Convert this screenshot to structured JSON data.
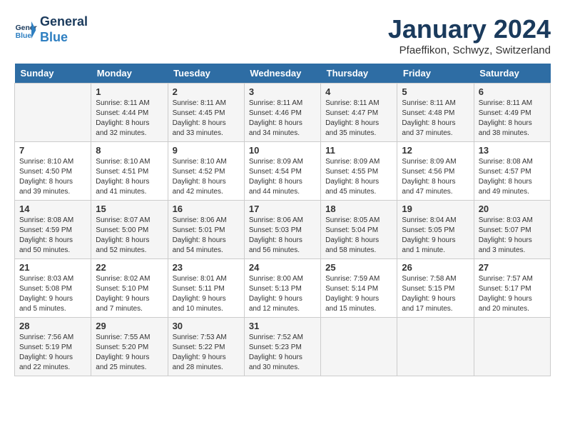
{
  "header": {
    "logo_line1": "General",
    "logo_line2": "Blue",
    "month_title": "January 2024",
    "subtitle": "Pfaeffikon, Schwyz, Switzerland"
  },
  "days_of_week": [
    "Sunday",
    "Monday",
    "Tuesday",
    "Wednesday",
    "Thursday",
    "Friday",
    "Saturday"
  ],
  "weeks": [
    [
      {
        "day": "",
        "sunrise": "",
        "sunset": "",
        "daylight": ""
      },
      {
        "day": "1",
        "sunrise": "8:11 AM",
        "sunset": "4:44 PM",
        "daylight": "8 hours and 32 minutes."
      },
      {
        "day": "2",
        "sunrise": "8:11 AM",
        "sunset": "4:45 PM",
        "daylight": "8 hours and 33 minutes."
      },
      {
        "day": "3",
        "sunrise": "8:11 AM",
        "sunset": "4:46 PM",
        "daylight": "8 hours and 34 minutes."
      },
      {
        "day": "4",
        "sunrise": "8:11 AM",
        "sunset": "4:47 PM",
        "daylight": "8 hours and 35 minutes."
      },
      {
        "day": "5",
        "sunrise": "8:11 AM",
        "sunset": "4:48 PM",
        "daylight": "8 hours and 37 minutes."
      },
      {
        "day": "6",
        "sunrise": "8:11 AM",
        "sunset": "4:49 PM",
        "daylight": "8 hours and 38 minutes."
      }
    ],
    [
      {
        "day": "7",
        "sunrise": "8:10 AM",
        "sunset": "4:50 PM",
        "daylight": "8 hours and 39 minutes."
      },
      {
        "day": "8",
        "sunrise": "8:10 AM",
        "sunset": "4:51 PM",
        "daylight": "8 hours and 41 minutes."
      },
      {
        "day": "9",
        "sunrise": "8:10 AM",
        "sunset": "4:52 PM",
        "daylight": "8 hours and 42 minutes."
      },
      {
        "day": "10",
        "sunrise": "8:09 AM",
        "sunset": "4:54 PM",
        "daylight": "8 hours and 44 minutes."
      },
      {
        "day": "11",
        "sunrise": "8:09 AM",
        "sunset": "4:55 PM",
        "daylight": "8 hours and 45 minutes."
      },
      {
        "day": "12",
        "sunrise": "8:09 AM",
        "sunset": "4:56 PM",
        "daylight": "8 hours and 47 minutes."
      },
      {
        "day": "13",
        "sunrise": "8:08 AM",
        "sunset": "4:57 PM",
        "daylight": "8 hours and 49 minutes."
      }
    ],
    [
      {
        "day": "14",
        "sunrise": "8:08 AM",
        "sunset": "4:59 PM",
        "daylight": "8 hours and 50 minutes."
      },
      {
        "day": "15",
        "sunrise": "8:07 AM",
        "sunset": "5:00 PM",
        "daylight": "8 hours and 52 minutes."
      },
      {
        "day": "16",
        "sunrise": "8:06 AM",
        "sunset": "5:01 PM",
        "daylight": "8 hours and 54 minutes."
      },
      {
        "day": "17",
        "sunrise": "8:06 AM",
        "sunset": "5:03 PM",
        "daylight": "8 hours and 56 minutes."
      },
      {
        "day": "18",
        "sunrise": "8:05 AM",
        "sunset": "5:04 PM",
        "daylight": "8 hours and 58 minutes."
      },
      {
        "day": "19",
        "sunrise": "8:04 AM",
        "sunset": "5:05 PM",
        "daylight": "9 hours and 1 minute."
      },
      {
        "day": "20",
        "sunrise": "8:03 AM",
        "sunset": "5:07 PM",
        "daylight": "9 hours and 3 minutes."
      }
    ],
    [
      {
        "day": "21",
        "sunrise": "8:03 AM",
        "sunset": "5:08 PM",
        "daylight": "9 hours and 5 minutes."
      },
      {
        "day": "22",
        "sunrise": "8:02 AM",
        "sunset": "5:10 PM",
        "daylight": "9 hours and 7 minutes."
      },
      {
        "day": "23",
        "sunrise": "8:01 AM",
        "sunset": "5:11 PM",
        "daylight": "9 hours and 10 minutes."
      },
      {
        "day": "24",
        "sunrise": "8:00 AM",
        "sunset": "5:13 PM",
        "daylight": "9 hours and 12 minutes."
      },
      {
        "day": "25",
        "sunrise": "7:59 AM",
        "sunset": "5:14 PM",
        "daylight": "9 hours and 15 minutes."
      },
      {
        "day": "26",
        "sunrise": "7:58 AM",
        "sunset": "5:15 PM",
        "daylight": "9 hours and 17 minutes."
      },
      {
        "day": "27",
        "sunrise": "7:57 AM",
        "sunset": "5:17 PM",
        "daylight": "9 hours and 20 minutes."
      }
    ],
    [
      {
        "day": "28",
        "sunrise": "7:56 AM",
        "sunset": "5:19 PM",
        "daylight": "9 hours and 22 minutes."
      },
      {
        "day": "29",
        "sunrise": "7:55 AM",
        "sunset": "5:20 PM",
        "daylight": "9 hours and 25 minutes."
      },
      {
        "day": "30",
        "sunrise": "7:53 AM",
        "sunset": "5:22 PM",
        "daylight": "9 hours and 28 minutes."
      },
      {
        "day": "31",
        "sunrise": "7:52 AM",
        "sunset": "5:23 PM",
        "daylight": "9 hours and 30 minutes."
      },
      {
        "day": "",
        "sunrise": "",
        "sunset": "",
        "daylight": ""
      },
      {
        "day": "",
        "sunrise": "",
        "sunset": "",
        "daylight": ""
      },
      {
        "day": "",
        "sunrise": "",
        "sunset": "",
        "daylight": ""
      }
    ]
  ]
}
